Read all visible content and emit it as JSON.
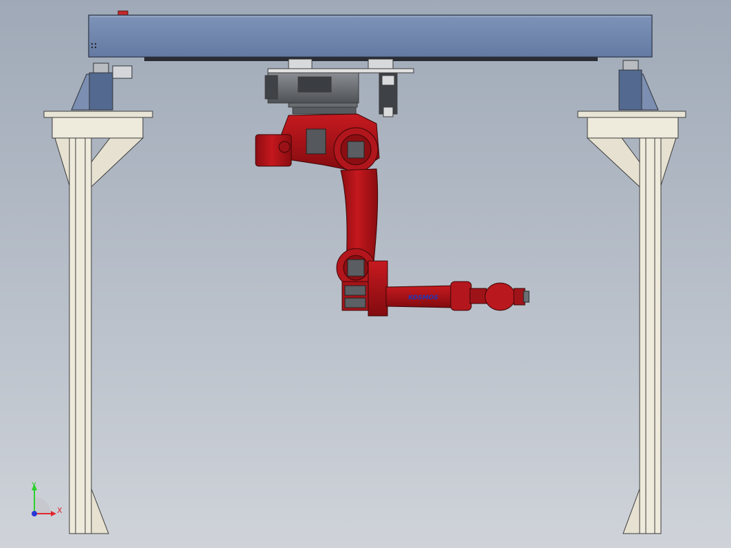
{
  "viewport": {
    "background_top": "#9fa9b7",
    "background_bottom": "#cfd3d9"
  },
  "colors": {
    "robot_red": "#b8141a",
    "robot_red_dark": "#6e0a0c",
    "beam_blue": "#6f86ad",
    "frame_cream": "#eeeadc",
    "frame_outline": "#3a3a3a",
    "motor_gray": "#5c5f63"
  },
  "robot": {
    "brand_label": "KOSMOS"
  },
  "triad": {
    "x_label": "X",
    "y_label": "Y",
    "x_color": "#e0262b",
    "y_color": "#2bd12b",
    "z_color": "#2a37d6"
  },
  "icons": [
    "coordinate-triad-icon"
  ]
}
